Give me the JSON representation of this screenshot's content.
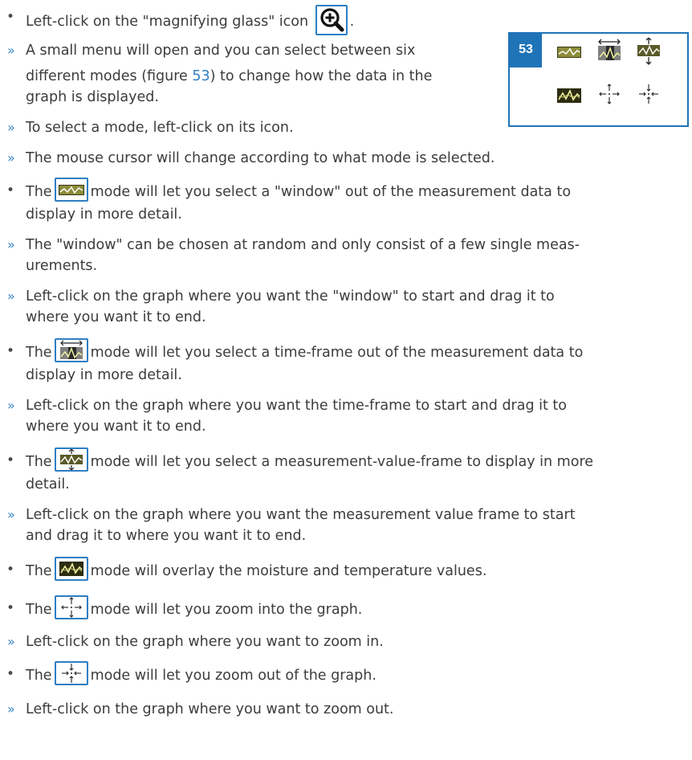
{
  "figure": {
    "number": "53"
  },
  "items": [
    {
      "type": "bullet",
      "parts": [
        "Left-click on the \"magnifying glass\" icon",
        "."
      ],
      "icon": "magnifying-glass-icon"
    },
    {
      "type": "sub",
      "lines": [
        "A small menu will open and you can select between six"
      ]
    },
    {
      "type": "sub-cont",
      "parts": [
        "different modes (figure ",
        "53",
        ") to change how the data in the"
      ]
    },
    {
      "type": "cont",
      "lines": [
        "graph is displayed."
      ]
    },
    {
      "type": "sub",
      "lines": [
        "To select a mode, left-click on its icon."
      ]
    },
    {
      "type": "sub",
      "lines": [
        "The mouse cursor will change according to what mode is selected."
      ]
    },
    {
      "type": "bullet",
      "parts": [
        "The",
        "mode will let you select a \"window\" out of the measurement data to"
      ],
      "icon": "window-zoom-icon",
      "cont": "display in more detail."
    },
    {
      "type": "sub",
      "lines": [
        "The \"window\" can be chosen at random and only consist of a few single meas-",
        "urements."
      ]
    },
    {
      "type": "sub",
      "lines": [
        "Left-click on the graph where you want the \"window\" to start and drag it to",
        "where you want it to end."
      ]
    },
    {
      "type": "bullet",
      "parts": [
        "The",
        "mode will let you select a time-frame out of the measurement data to"
      ],
      "icon": "time-frame-zoom-icon",
      "cont": "display in more detail."
    },
    {
      "type": "sub",
      "lines": [
        "Left-click on the graph where you want the time-frame to start and drag it to",
        "where you want it to end."
      ]
    },
    {
      "type": "bullet",
      "parts": [
        "The",
        "mode will let you select a measurement-value-frame to display in more"
      ],
      "icon": "value-frame-zoom-icon",
      "cont": "detail."
    },
    {
      "type": "sub",
      "lines": [
        "Left-click on the graph where you want the measurement value frame to start",
        "and drag it to where you want it to end."
      ]
    },
    {
      "type": "bullet",
      "parts": [
        "The",
        "mode will overlay the moisture and temperature values."
      ],
      "icon": "overlay-icon"
    },
    {
      "type": "bullet",
      "parts": [
        "The",
        "mode will let you zoom into the graph."
      ],
      "icon": "zoom-in-arrows-icon"
    },
    {
      "type": "sub",
      "lines": [
        "Left-click on the graph where you want to zoom in."
      ]
    },
    {
      "type": "bullet",
      "parts": [
        "The",
        "mode will let you zoom out of the graph."
      ],
      "icon": "zoom-out-arrows-icon"
    },
    {
      "type": "sub",
      "lines": [
        "Left-click on the graph where you want to zoom out."
      ]
    }
  ],
  "markers": {
    "bullet": "•",
    "sub": "»"
  },
  "colors": {
    "accent": "#1f73b7",
    "icon_border": "#2f7ec2",
    "marker": "#3a86c6",
    "text": "#3c3c3c"
  }
}
